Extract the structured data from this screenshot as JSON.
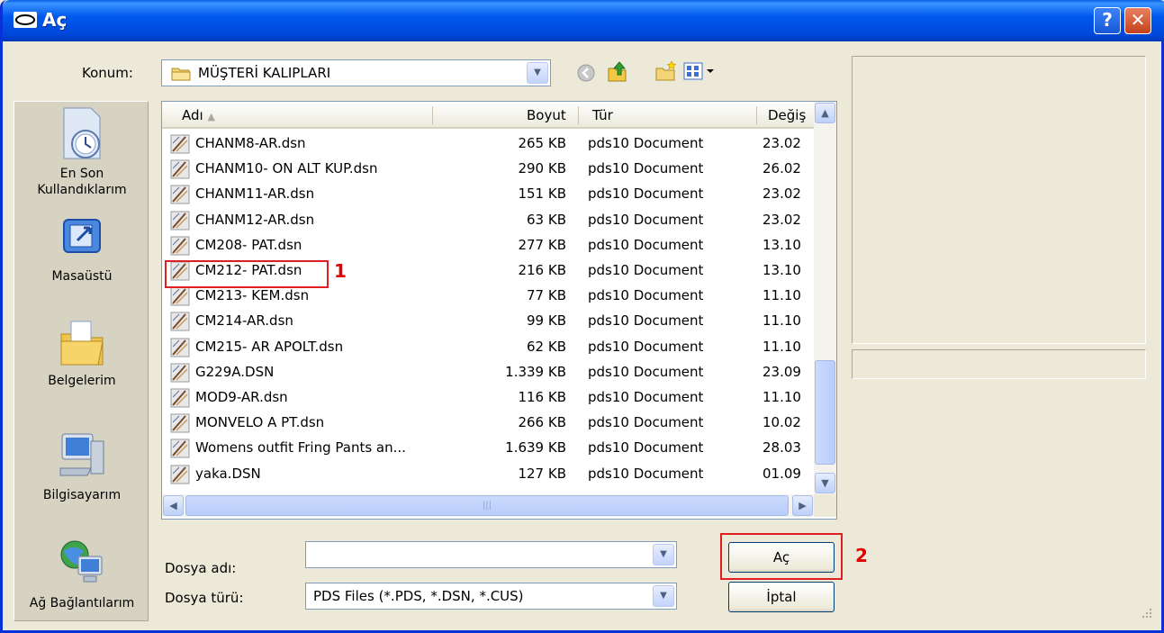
{
  "window": {
    "title": "Aç",
    "help_glyph": "?",
    "close_glyph": "✕"
  },
  "location": {
    "label": "Konum:",
    "value": "MÜŞTERİ KALIPLARI"
  },
  "places": [
    {
      "label": "En Son Kullandıklarım",
      "icon": "recent-clock-icon"
    },
    {
      "label": "Masaüstü",
      "icon": "desktop-icon"
    },
    {
      "label": "Belgelerim",
      "icon": "documents-folder-icon"
    },
    {
      "label": "Bilgisayarım",
      "icon": "computer-icon"
    },
    {
      "label": "Ağ Bağlantılarım",
      "icon": "network-globe-icon"
    }
  ],
  "columns": {
    "name": "Adı",
    "size": "Boyut",
    "type": "Tür",
    "date": "Değiş"
  },
  "files": [
    {
      "name": "CHANM8-AR.dsn",
      "size": "265 KB",
      "type": "pds10 Document",
      "date": "23.02"
    },
    {
      "name": "CHANM10- ON ALT KUP.dsn",
      "size": "290 KB",
      "type": "pds10 Document",
      "date": "26.02"
    },
    {
      "name": "CHANM11-AR.dsn",
      "size": "151 KB",
      "type": "pds10 Document",
      "date": "23.02"
    },
    {
      "name": "CHANM12-AR.dsn",
      "size": "63 KB",
      "type": "pds10 Document",
      "date": "23.02"
    },
    {
      "name": "CM208- PAT.dsn",
      "size": "277 KB",
      "type": "pds10 Document",
      "date": "13.10"
    },
    {
      "name": "CM212- PAT.dsn",
      "size": "216 KB",
      "type": "pds10 Document",
      "date": "13.10"
    },
    {
      "name": "CM213- KEM.dsn",
      "size": "77 KB",
      "type": "pds10 Document",
      "date": "11.10"
    },
    {
      "name": "CM214-AR.dsn",
      "size": "99 KB",
      "type": "pds10 Document",
      "date": "11.10"
    },
    {
      "name": "CM215- AR APOLT.dsn",
      "size": "62 KB",
      "type": "pds10 Document",
      "date": "11.10"
    },
    {
      "name": "G229A.DSN",
      "size": "1.339 KB",
      "type": "pds10 Document",
      "date": "23.09"
    },
    {
      "name": "MOD9-AR.dsn",
      "size": "116 KB",
      "type": "pds10 Document",
      "date": "11.10"
    },
    {
      "name": "MONVELO A PT.dsn",
      "size": "266 KB",
      "type": "pds10 Document",
      "date": "10.02"
    },
    {
      "name": "Womens outfit Fring Pants an...",
      "size": "1.639 KB",
      "type": "pds10 Document",
      "date": "28.03"
    },
    {
      "name": "yaka.DSN",
      "size": "127 KB",
      "type": "pds10 Document",
      "date": "01.09"
    }
  ],
  "filename": {
    "label": "Dosya adı:",
    "value": ""
  },
  "filetype": {
    "label": "Dosya türü:",
    "value": "PDS Files (*.PDS, *.DSN, *.CUS)"
  },
  "buttons": {
    "open": "Aç",
    "cancel": "İptal"
  },
  "annotations": {
    "step1": "1",
    "step2": "2",
    "color": "#e00000"
  }
}
